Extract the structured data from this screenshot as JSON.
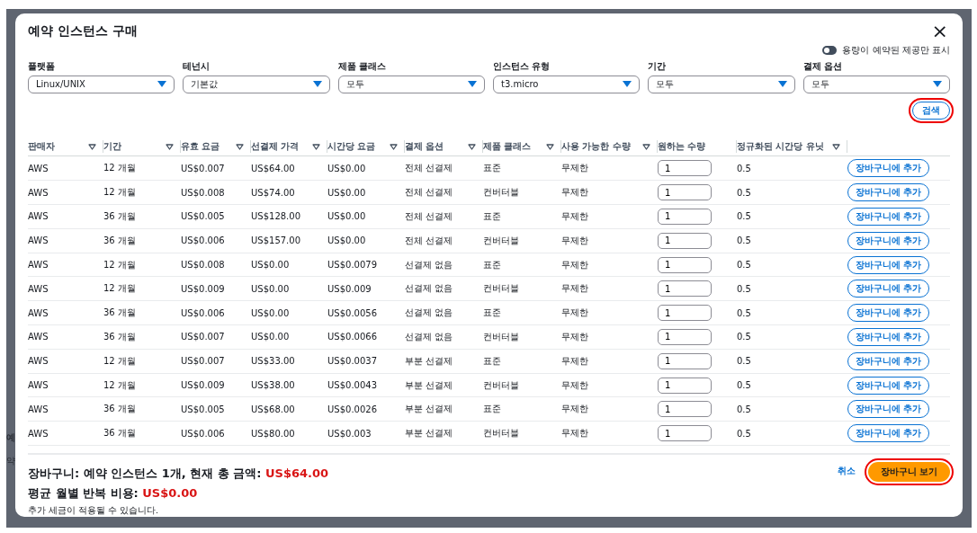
{
  "background": {
    "texts": [
      "예",
      "약"
    ]
  },
  "modal": {
    "title": "예약 인스턴스 구매",
    "close": "×",
    "toggle": {
      "label": "용량이 예약된 제공만 표시",
      "on": false
    },
    "filters": [
      {
        "label": "플랫폼",
        "value": "Linux/UNIX"
      },
      {
        "label": "테넌시",
        "value": "기본값"
      },
      {
        "label": "제품 클래스",
        "value": "모두"
      },
      {
        "label": "인스턴스 유형",
        "value": "t3.micro"
      },
      {
        "label": "기간",
        "value": "모두"
      },
      {
        "label": "결제 옵션",
        "value": "모두"
      }
    ],
    "search_button": {
      "label": "검색",
      "highlighted": true
    },
    "table": {
      "columns": [
        {
          "label": "판매자",
          "sortable": true
        },
        {
          "label": "기간",
          "sortable": true
        },
        {
          "label": "유효 요금",
          "sortable": true
        },
        {
          "label": "선결제 가격",
          "sortable": true
        },
        {
          "label": "시간당 요금",
          "sortable": true
        },
        {
          "label": "결제 옵션",
          "sortable": true
        },
        {
          "label": "제품 클래스",
          "sortable": true
        },
        {
          "label": "사용 가능한 수량",
          "sortable": true
        },
        {
          "label": "원하는 수량",
          "sortable": false
        },
        {
          "label": "정규화된 시간당 유닛",
          "sortable": true
        }
      ],
      "rows": [
        {
          "cells": [
            "AWS",
            "12 개월",
            "US$0.007",
            "US$64.00",
            "US$0.00",
            "전체 선결제",
            "표준",
            "무제한"
          ],
          "quantity": "1",
          "units": "0.5",
          "action": "장바구니에 추가"
        },
        {
          "cells": [
            "AWS",
            "12 개월",
            "US$0.008",
            "US$74.00",
            "US$0.00",
            "전체 선결제",
            "컨버터블",
            "무제한"
          ],
          "quantity": "1",
          "units": "0.5",
          "action": "장바구니에 추가"
        },
        {
          "cells": [
            "AWS",
            "36 개월",
            "US$0.005",
            "US$128.00",
            "US$0.00",
            "전체 선결제",
            "표준",
            "무제한"
          ],
          "quantity": "1",
          "units": "0.5",
          "action": "장바구니에 추가"
        },
        {
          "cells": [
            "AWS",
            "36 개월",
            "US$0.006",
            "US$157.00",
            "US$0.00",
            "전체 선결제",
            "컨버터블",
            "무제한"
          ],
          "quantity": "1",
          "units": "0.5",
          "action": "장바구니에 추가"
        },
        {
          "cells": [
            "AWS",
            "12 개월",
            "US$0.008",
            "US$0.00",
            "US$0.0079",
            "선결제 없음",
            "표준",
            "무제한"
          ],
          "quantity": "1",
          "units": "0.5",
          "action": "장바구니에 추가"
        },
        {
          "cells": [
            "AWS",
            "12 개월",
            "US$0.009",
            "US$0.00",
            "US$0.009",
            "선결제 없음",
            "컨버터블",
            "무제한"
          ],
          "quantity": "1",
          "units": "0.5",
          "action": "장바구니에 추가"
        },
        {
          "cells": [
            "AWS",
            "36 개월",
            "US$0.006",
            "US$0.00",
            "US$0.0056",
            "선결제 없음",
            "표준",
            "무제한"
          ],
          "quantity": "1",
          "units": "0.5",
          "action": "장바구니에 추가"
        },
        {
          "cells": [
            "AWS",
            "36 개월",
            "US$0.007",
            "US$0.00",
            "US$0.0066",
            "선결제 없음",
            "컨버터블",
            "무제한"
          ],
          "quantity": "1",
          "units": "0.5",
          "action": "장바구니에 추가"
        },
        {
          "cells": [
            "AWS",
            "12 개월",
            "US$0.007",
            "US$33.00",
            "US$0.0037",
            "부분 선결제",
            "표준",
            "무제한"
          ],
          "quantity": "1",
          "units": "0.5",
          "action": "장바구니에 추가"
        },
        {
          "cells": [
            "AWS",
            "12 개월",
            "US$0.009",
            "US$38.00",
            "US$0.0043",
            "부분 선결제",
            "컨버터블",
            "무제한"
          ],
          "quantity": "1",
          "units": "0.5",
          "action": "장바구니에 추가"
        },
        {
          "cells": [
            "AWS",
            "36 개월",
            "US$0.005",
            "US$68.00",
            "US$0.0026",
            "부분 선결제",
            "표준",
            "무제한"
          ],
          "quantity": "1",
          "units": "0.5",
          "action": "장바구니에 추가"
        },
        {
          "cells": [
            "AWS",
            "36 개월",
            "US$0.006",
            "US$80.00",
            "US$0.003",
            "부분 선결제",
            "컨버터블",
            "무제한"
          ],
          "quantity": "1",
          "units": "0.5",
          "action": "장바구니에 추가"
        }
      ]
    },
    "summary": {
      "cart_label": "장바구니: 예약 인스턴스 1개, 현재 총 금액:",
      "cart_total": "US$64.00",
      "monthly_label": "평균 월별 반복 비용:",
      "monthly_total": "US$0.00",
      "note": "추가 세금이 적용될 수 있습니다."
    },
    "cancel": "취소",
    "view_cart_button": {
      "label": "장바구니 보기",
      "highlighted": true
    }
  }
}
